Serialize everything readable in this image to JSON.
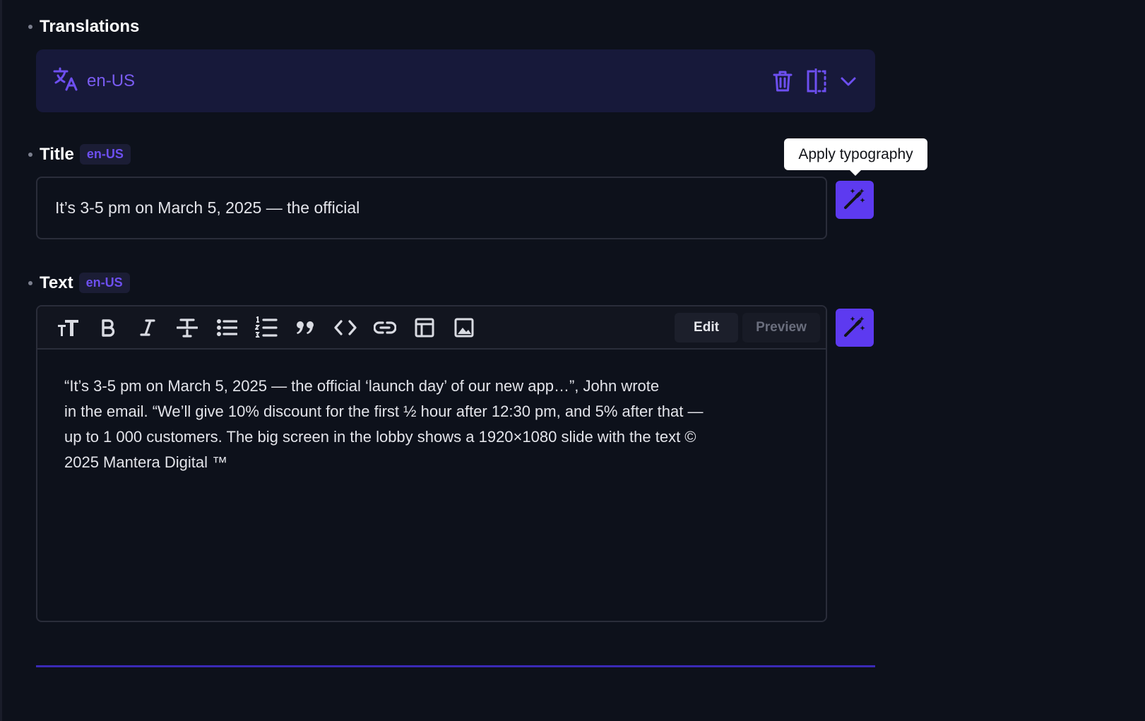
{
  "translations": {
    "label": "Translations",
    "lang": "en-US",
    "icons": [
      "translate-icon",
      "trash-icon",
      "split-view-icon",
      "chevron-down-icon"
    ]
  },
  "title_field": {
    "label": "Title",
    "chip": "en-US",
    "value": "It’s 3-5 pm on March 5, 2025 — the official"
  },
  "tooltip": {
    "text": "Apply typography"
  },
  "text_field": {
    "label": "Text",
    "chip": "en-US",
    "toolbar": {
      "icons": [
        "heading-icon",
        "bold-icon",
        "italic-icon",
        "strikethrough-icon",
        "bulleted-list-icon",
        "numbered-list-icon",
        "quote-icon",
        "code-icon",
        "link-icon",
        "table-icon",
        "image-icon"
      ],
      "edit_label": "Edit",
      "preview_label": "Preview"
    },
    "body": {
      "line1": "“It’s 3-5 pm on March 5, 2025 — the official ‘launch day’ of our new app…”, John wrote",
      "line2": "in the email. “We’ll give 10% discount for the first ½ hour after 12:30 pm, and 5% after that —",
      "line3": "up to 1 000 customers. The big screen in the lobby shows a 1920×1080 slide with the text ©",
      "line4": "2025 Mantera Digital ™"
    }
  },
  "colors": {
    "background": "#0d111b",
    "accent": "#5d3af0",
    "accent_text": "#7a5cf2",
    "panel": "#17193a"
  }
}
